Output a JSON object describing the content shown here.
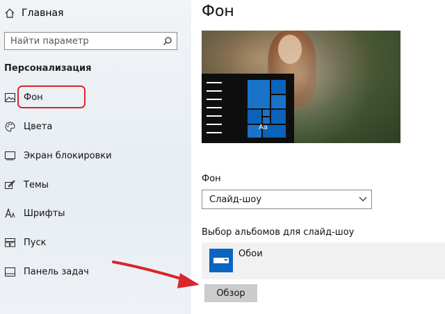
{
  "sidebar": {
    "home_label": "Главная",
    "search_placeholder": "Найти параметр",
    "section_title": "Персонализация",
    "items": [
      {
        "label": "Фон",
        "icon": "picture-icon"
      },
      {
        "label": "Цвета",
        "icon": "palette-icon"
      },
      {
        "label": "Экран блокировки",
        "icon": "lock-screen-icon"
      },
      {
        "label": "Темы",
        "icon": "themes-icon"
      },
      {
        "label": "Шрифты",
        "icon": "fonts-icon"
      },
      {
        "label": "Пуск",
        "icon": "start-icon"
      },
      {
        "label": "Панель задач",
        "icon": "taskbar-icon"
      }
    ],
    "active_index": 0
  },
  "main": {
    "title": "Фон",
    "preview_tile_label": "Aa",
    "background_label": "Фон",
    "background_value": "Слайд-шоу",
    "albums_label": "Выбор альбомов для слайд-шоу",
    "album_name": "Обои",
    "browse_label": "Обзор"
  },
  "colors": {
    "accent": "#0a64c2",
    "highlight_box": "#d9262b",
    "annotation_arrow": "#d9262b"
  }
}
